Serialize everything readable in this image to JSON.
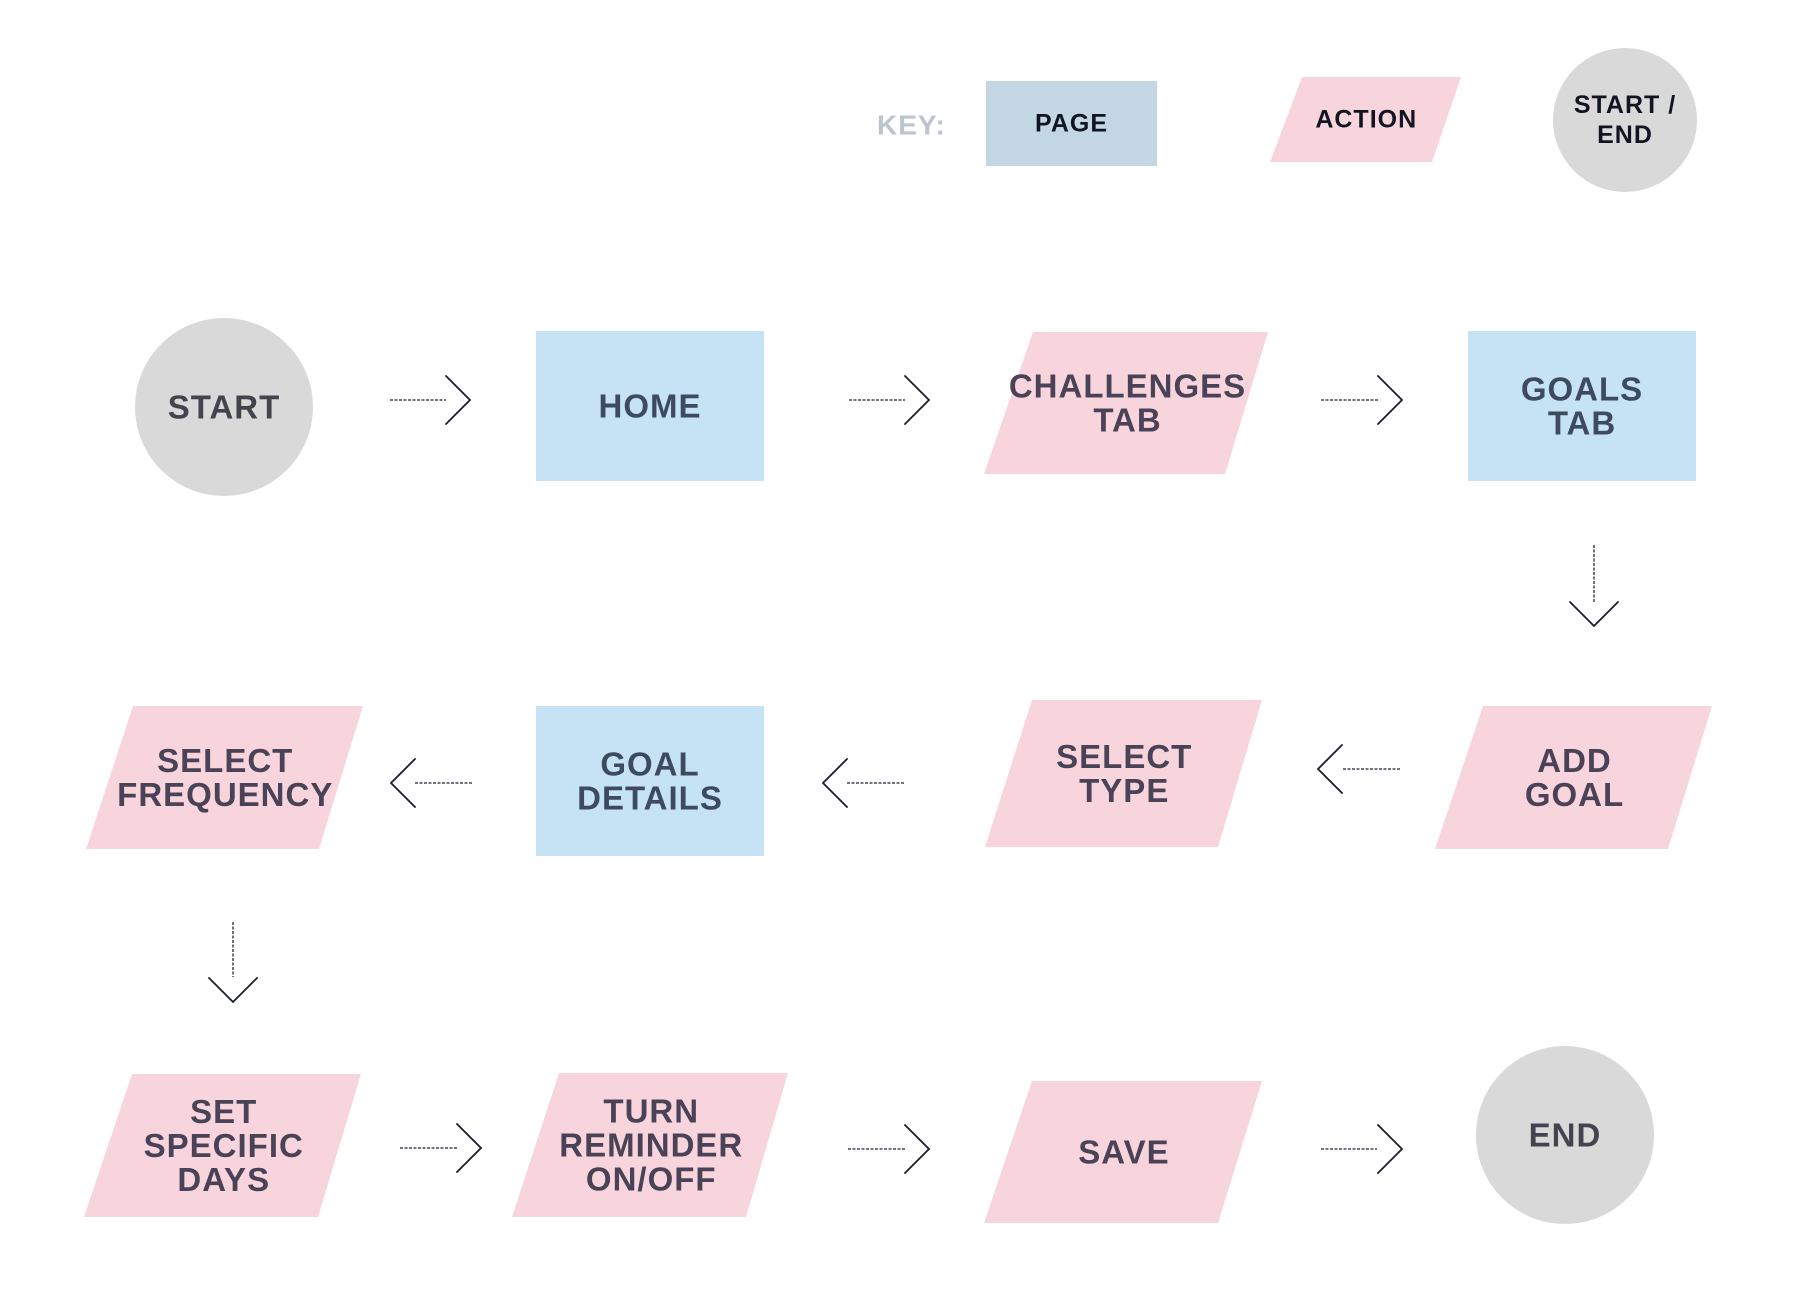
{
  "colors": {
    "page_fill": "#c5e3f5",
    "page_text": "#3e4a5e",
    "action_fill": "#f8d5dc",
    "action_text": "#4a4257",
    "terminal_fill": "#d9d9d9",
    "terminal_text": "#44444f",
    "key_label": "#bcc4cf",
    "key_page_fill": "#c2d6e4",
    "key_text": "#111522",
    "connector": "#1f2233"
  },
  "key": {
    "label": "KEY:",
    "items": [
      {
        "type": "page",
        "lines": [
          "PAGE"
        ]
      },
      {
        "type": "action",
        "lines": [
          "ACTION"
        ]
      },
      {
        "type": "terminal",
        "lines": [
          "START /",
          "END"
        ]
      }
    ]
  },
  "nodes": [
    {
      "id": "start",
      "type": "terminal",
      "lines": [
        "START"
      ]
    },
    {
      "id": "home",
      "type": "page",
      "lines": [
        "HOME"
      ]
    },
    {
      "id": "challenges-tab",
      "type": "action",
      "lines": [
        "CHALLENGES",
        "TAB"
      ]
    },
    {
      "id": "goals-tab",
      "type": "page",
      "lines": [
        "GOALS",
        "TAB"
      ]
    },
    {
      "id": "add-goal",
      "type": "action",
      "lines": [
        "ADD",
        "GOAL"
      ]
    },
    {
      "id": "select-type",
      "type": "action",
      "lines": [
        "SELECT",
        "TYPE"
      ]
    },
    {
      "id": "goal-details",
      "type": "page",
      "lines": [
        "GOAL",
        "DETAILS"
      ]
    },
    {
      "id": "select-frequency",
      "type": "action",
      "lines": [
        "SELECT",
        "FREQUENCY"
      ]
    },
    {
      "id": "set-specific-days",
      "type": "action",
      "lines": [
        "SET",
        "SPECIFIC",
        "DAYS"
      ]
    },
    {
      "id": "turn-reminder",
      "type": "action",
      "lines": [
        "TURN",
        "REMINDER",
        "ON/OFF"
      ]
    },
    {
      "id": "save",
      "type": "action",
      "lines": [
        "SAVE"
      ]
    },
    {
      "id": "end",
      "type": "terminal",
      "lines": [
        "END"
      ]
    }
  ],
  "edges": [
    {
      "from": "start",
      "to": "home",
      "direction": "right"
    },
    {
      "from": "home",
      "to": "challenges-tab",
      "direction": "right"
    },
    {
      "from": "challenges-tab",
      "to": "goals-tab",
      "direction": "right"
    },
    {
      "from": "goals-tab",
      "to": "add-goal",
      "direction": "down"
    },
    {
      "from": "add-goal",
      "to": "select-type",
      "direction": "left"
    },
    {
      "from": "select-type",
      "to": "goal-details",
      "direction": "left"
    },
    {
      "from": "goal-details",
      "to": "select-frequency",
      "direction": "left"
    },
    {
      "from": "select-frequency",
      "to": "set-specific-days",
      "direction": "down"
    },
    {
      "from": "set-specific-days",
      "to": "turn-reminder",
      "direction": "right"
    },
    {
      "from": "turn-reminder",
      "to": "save",
      "direction": "right"
    },
    {
      "from": "save",
      "to": "end",
      "direction": "right"
    }
  ]
}
